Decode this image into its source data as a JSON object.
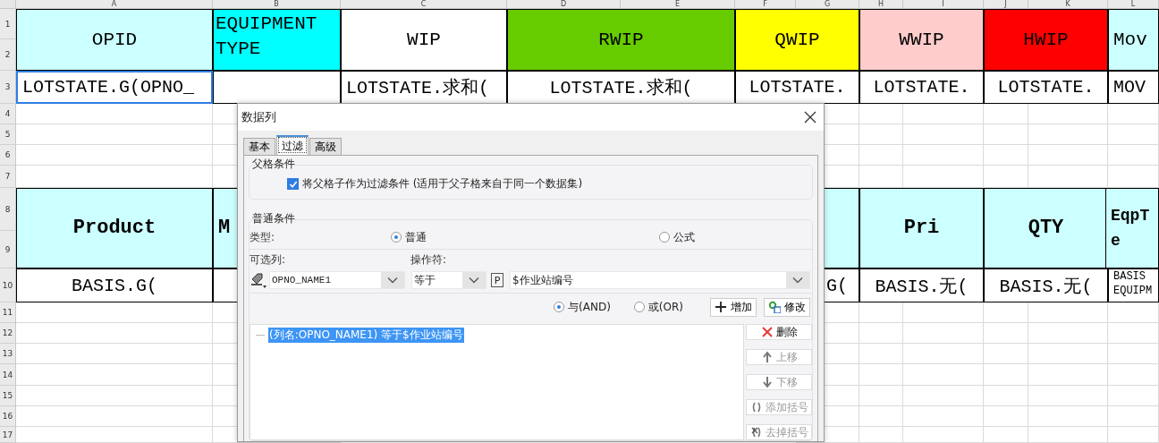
{
  "sheet": {
    "column_headers": [
      "A",
      "B",
      "C",
      "D",
      "E",
      "F",
      "G",
      "H",
      "I",
      "J",
      "K",
      "L"
    ],
    "row_headers": [
      "1",
      "2",
      "3",
      "4",
      "5",
      "6",
      "7",
      "8",
      "9",
      "10",
      "11",
      "12",
      "13",
      "14",
      "15",
      "16",
      "17"
    ],
    "cells": [
      {
        "text": "OPID",
        "color": "#ccffff",
        "selected": false
      },
      {
        "text": "EQUIPMENT TYPE",
        "color": "#00ffff",
        "selected": false
      },
      {
        "text": "WIP",
        "color": "#ffffff",
        "selected": false
      },
      {
        "text": "RWIP",
        "color": "#66cc00",
        "selected": false
      },
      {
        "text": "QWIP",
        "color": "#ffff00",
        "selected": false
      },
      {
        "text": "WWIP",
        "color": "#ffcccc",
        "selected": false
      },
      {
        "text": "HWIP",
        "color": "#ff0000",
        "selected": false
      },
      {
        "text": "Mov",
        "color": "#ccffff",
        "selected": false
      },
      {
        "text": "LOTSTATE.G(OPNO_",
        "color": "#ffffff",
        "selected": true
      },
      {
        "color": "#ffffff",
        "selected": false
      },
      {
        "text": "LOTSTATE.求和(",
        "color": "#ffffff",
        "selected": false
      },
      {
        "text": "LOTSTATE.求和(",
        "color": "#ffffff",
        "selected": false
      },
      {
        "text": "LOTSTATE.",
        "color": "#ffffff",
        "selected": false
      },
      {
        "text": "LOTSTATE.",
        "color": "#ffffff",
        "selected": false
      },
      {
        "text": "LOTSTATE.",
        "color": "#ffffff",
        "selected": false
      },
      {
        "text": "MOV",
        "color": "#ffffff",
        "selected": false
      },
      {
        "text": "Product",
        "color": "#ccffff",
        "selected": false
      },
      {
        "text": "M",
        "color": "#ccffff",
        "selected": false
      },
      {
        "color": "#ccffff",
        "selected": false
      },
      {
        "text": "Pri",
        "color": "#ccffff",
        "selected": false
      },
      {
        "text": "QTY",
        "color": "#ccffff",
        "selected": false
      },
      {
        "text": "EqpT\ne",
        "color": "#ccffff",
        "selected": false
      },
      {
        "text": "BASIS.G(",
        "color": "#ffffff",
        "selected": false
      },
      {
        "color": "#ffffff",
        "selected": false
      },
      {
        "text": "G(",
        "color": "#ffffff",
        "selected": false
      },
      {
        "text": "BASIS.无(",
        "color": "#ffffff",
        "selected": false
      },
      {
        "text": "BASIS.无(",
        "color": "#ffffff",
        "selected": false
      },
      {
        "text": "BASIS\nEQUIPM",
        "color": "#ffffff",
        "selected": false
      }
    ]
  },
  "dialog": {
    "title": "数据列",
    "tabs": [
      {
        "label": "基本",
        "selected": false
      },
      {
        "label": "过滤",
        "selected": true
      },
      {
        "label": "高级",
        "selected": false
      }
    ],
    "parent_condition": {
      "title": "父格条件",
      "checkbox": {
        "label": "将父格子作为过滤条件 (适用于父子格来自于同一个数据集)",
        "checked": true
      }
    },
    "normal_condition": {
      "title": "普通条件",
      "type_label": "类型:",
      "type_options": [
        {
          "label": "普通",
          "selected": true
        },
        {
          "label": "公式",
          "selected": false
        }
      ],
      "column_label": "可选列:",
      "operator_label": "操作符:",
      "column_value": "OPNO_NAME1",
      "operator_value": "等于",
      "parameter_marker": "P",
      "value": "$作业站编号",
      "logic_options": [
        {
          "label": "与(AND)",
          "selected": true
        },
        {
          "label": "或(OR)",
          "selected": false
        }
      ],
      "action_buttons": [
        {
          "label": "增加"
        },
        {
          "label": "修改"
        }
      ],
      "conditions": [
        {
          "text": "(列名:OPNO_NAME1) 等于$作业站编号",
          "selected": true
        }
      ],
      "list_buttons": [
        {
          "label": "删除",
          "disabled": false
        },
        {
          "label": "上移",
          "disabled": true
        },
        {
          "label": "下移",
          "disabled": true
        },
        {
          "label": "添加括号",
          "disabled": true
        },
        {
          "label": "去掉括号",
          "disabled": true
        }
      ]
    }
  }
}
